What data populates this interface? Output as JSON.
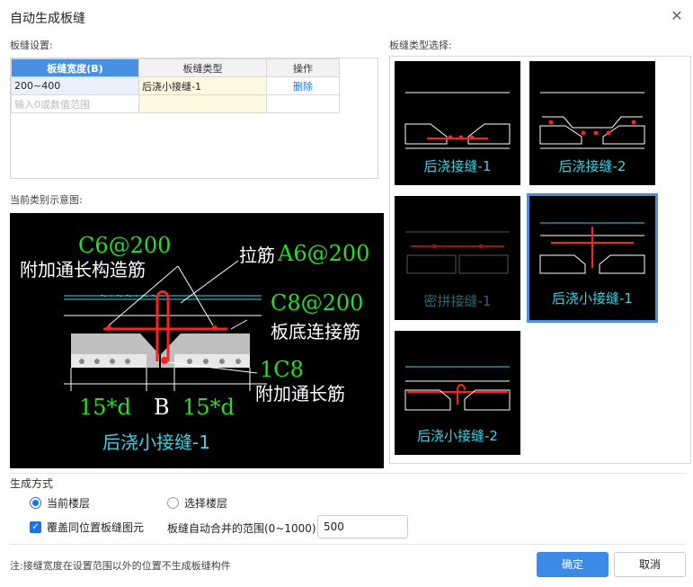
{
  "window": {
    "title": "自动生成板缝",
    "close_glyph": "✕"
  },
  "settings": {
    "label": "板缝设置:",
    "columns": [
      "板缝宽度(B)",
      "板缝类型",
      "操作"
    ],
    "row": {
      "width": "200~400",
      "type": "后浇小接缝-1",
      "op": "删除"
    },
    "input_placeholder": "输入0或数值范围"
  },
  "preview": {
    "label": "当前类别示意图:",
    "annotations": {
      "c6": "C6@200",
      "addl_struct": "附加通长构造筋",
      "tie": "拉筋",
      "a6": "A6@200",
      "c8": "C8@200",
      "bottom_conn": "板底连接筋",
      "c1": "1C8",
      "addl_long": "附加通长筋",
      "d_left": "15*d",
      "b": "B",
      "d_right": "15*d",
      "name": "后浇小接缝-1"
    }
  },
  "gallery": {
    "label": "板缝类型选择:",
    "items": [
      {
        "label": "后浇接缝-1"
      },
      {
        "label": "后浇接缝-2"
      },
      {
        "label": "密拼接缝-1"
      },
      {
        "label": "后浇小接缝-1"
      },
      {
        "label": "后浇小接缝-2"
      }
    ],
    "selected": "后浇小接缝-1"
  },
  "generate": {
    "label": "生成方式",
    "current_floor": "当前楼层",
    "select_floor": "选择楼层",
    "selected_option": "当前楼层",
    "overwrite": "覆盖同位置板缝图元",
    "overwrite_checked": true,
    "merge_label": "板缝自动合并的范围(0~1000):",
    "merge_value": "500"
  },
  "footer": {
    "note": "注:接缝宽度在设置范围以外的位置不生成板缝构件",
    "ok": "确定",
    "cancel": "取消"
  },
  "colors": {
    "accent": "#3b8be6",
    "cad_green": "#22e022",
    "cad_cyan": "#33d6e8",
    "cad_red": "#ff2020"
  }
}
